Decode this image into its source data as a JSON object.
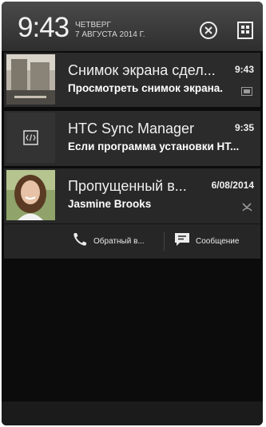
{
  "header": {
    "time": "9:43",
    "day": "ЧЕТВЕРГ",
    "date": "7 АВГУСТА 2014 Г.",
    "clear_icon": "circle-x-icon",
    "settings_icon": "quick-settings-icon"
  },
  "notifications": [
    {
      "title": "Снимок экрана сдел...",
      "subtitle": "Просмотреть снимок экрана.",
      "time": "9:43",
      "icon": "image-icon"
    },
    {
      "title": "HTC Sync Manager",
      "subtitle": "Если программа установки HT...",
      "time": "9:35",
      "icon": "code-icon"
    },
    {
      "title": "Пропущенный в...",
      "subtitle": "Jasmine Brooks",
      "time": "6/08/2014",
      "icon": "missed-call-icon",
      "actions": [
        {
          "label": "Обратный в...",
          "icon": "phone-icon"
        },
        {
          "label": "Сообщение",
          "icon": "message-icon"
        }
      ]
    }
  ],
  "colors": {
    "panel": "#2b2b2b",
    "header_top": "#4a4a4a",
    "background": "#0c0c0c"
  }
}
